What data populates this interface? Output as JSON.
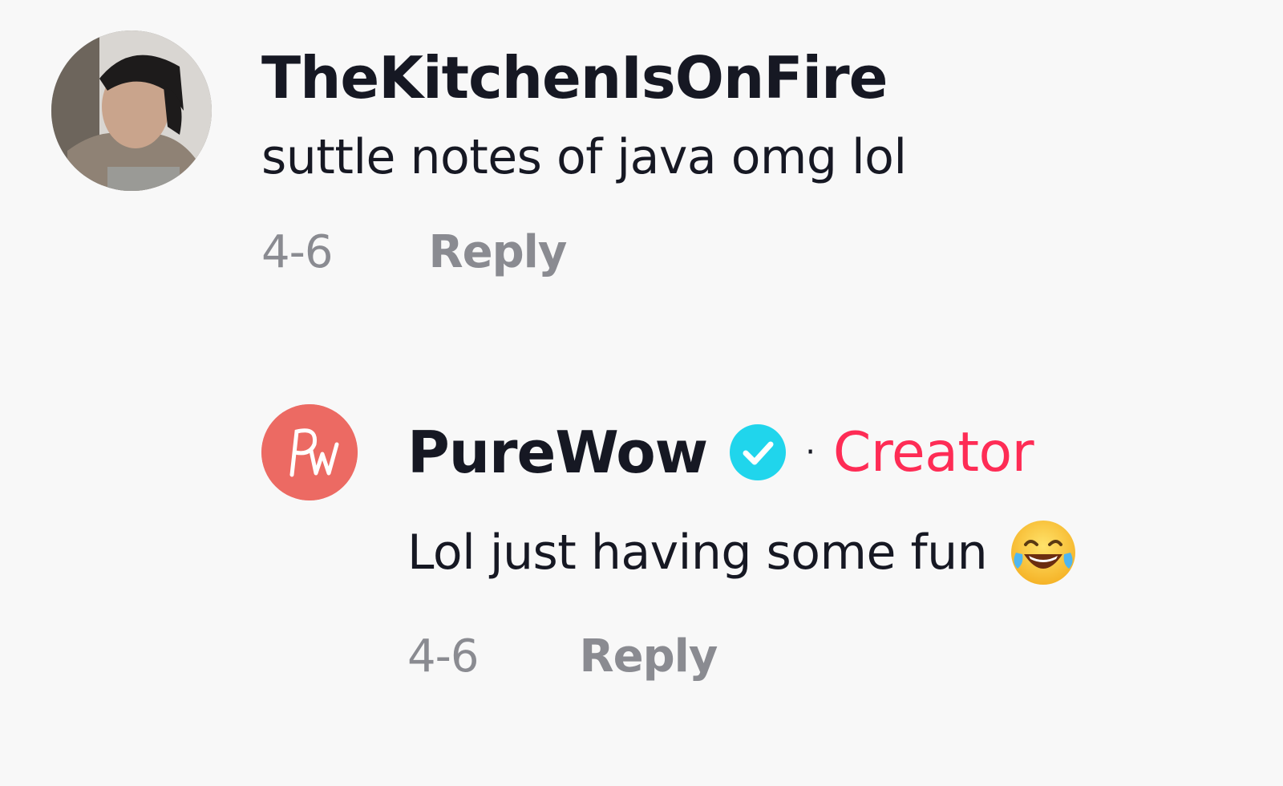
{
  "comments": [
    {
      "username": "TheKitchenIsOnFire",
      "text": "suttle notes of java omg lol",
      "date": "4-6",
      "reply_label": "Reply"
    },
    {
      "username": "PureWow",
      "verified": true,
      "separator": "·",
      "badge": "Creator",
      "text": "Lol just having some fun",
      "emoji": "face-with-tears-of-joy",
      "date": "4-6",
      "reply_label": "Reply",
      "avatar_logo": "Pw"
    }
  ],
  "colors": {
    "background": "#f8f8f8",
    "text": "#161823",
    "muted": "#8a8b91",
    "creator": "#fe2c55",
    "verified": "#20d5ec",
    "purewow_avatar": "#ec6a63"
  }
}
